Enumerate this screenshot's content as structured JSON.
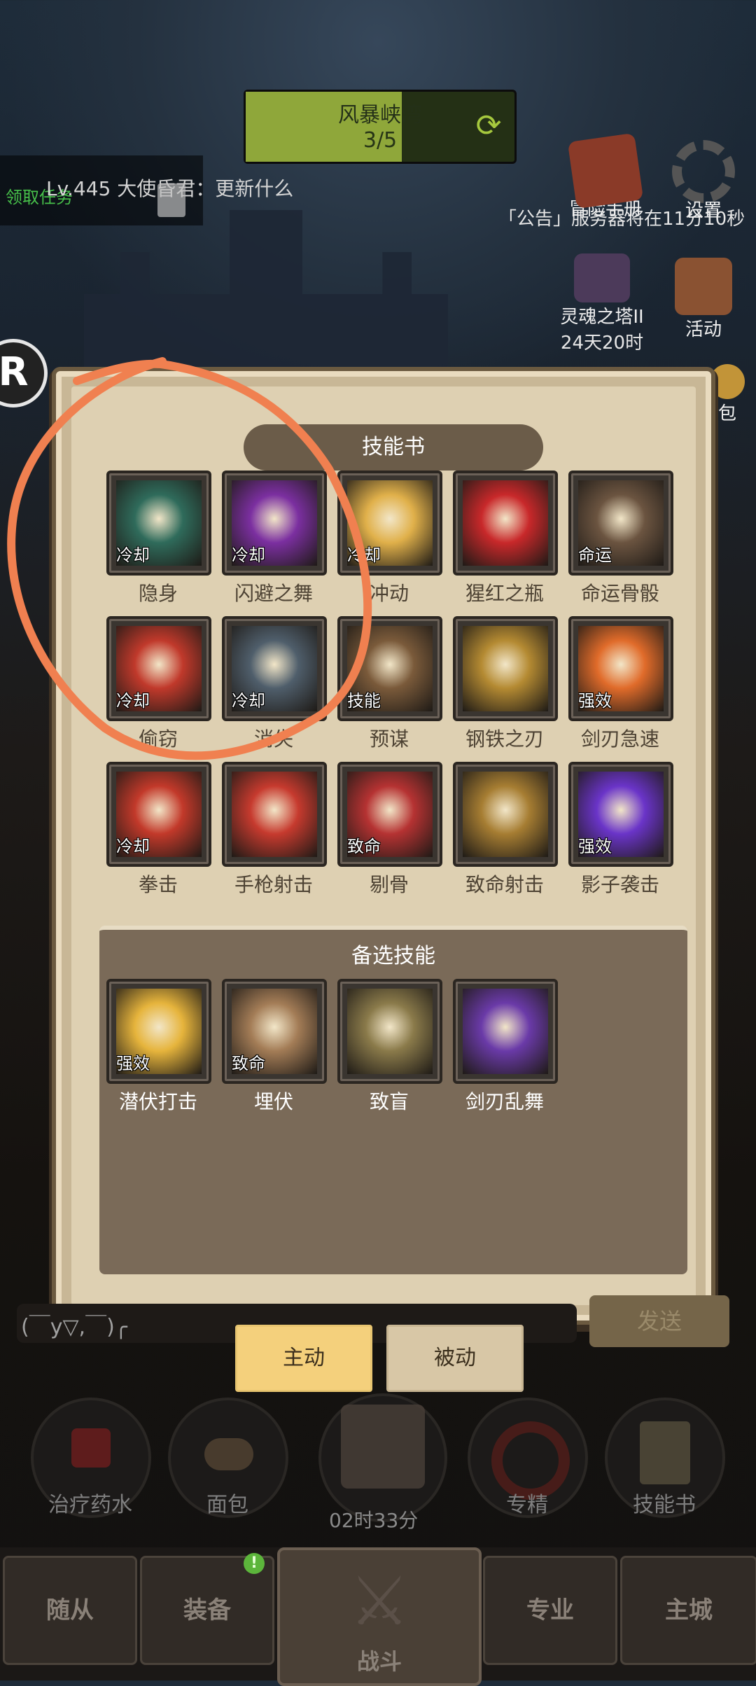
{
  "hud": {
    "stage_name": "风暴峡湾",
    "stage_progress": "3/5",
    "chat_task": "领取任务",
    "chat_message": "Lv.445 大使昏君：更新什么",
    "announcement": "「公告」服务器将在11分10秒",
    "adventure_label": "冒险手册",
    "settings_label": "设置",
    "soul_tower_label": "灵魂之塔II",
    "soul_tower_time": "24天20时",
    "activity_label": "活动",
    "bag_label": "包",
    "round_badge": "R"
  },
  "panel": {
    "title": "技能书",
    "skills": [
      {
        "name": "隐身",
        "tag": "冷却",
        "icon": "hooded-figure-icon",
        "color": "#2f6b5b"
      },
      {
        "name": "闪避之舞",
        "tag": "冷却",
        "icon": "purple-shadow-icon",
        "color": "#7b2fa0"
      },
      {
        "name": "冲动",
        "tag": "冷却",
        "icon": "spiral-burst-icon",
        "color": "#e0b04a"
      },
      {
        "name": "猩红之瓶",
        "tag": "",
        "icon": "red-potion-icon",
        "color": "#c8282a"
      },
      {
        "name": "命运骨骰",
        "tag": "命运",
        "icon": "bone-dice-icon",
        "color": "#6b5440"
      },
      {
        "name": "偷窃",
        "tag": "冷却",
        "icon": "red-bag-icon",
        "color": "#c0392b"
      },
      {
        "name": "消失",
        "tag": "冷却",
        "icon": "grey-rock-icon",
        "color": "#4f5e6b"
      },
      {
        "name": "预谋",
        "tag": "技能",
        "icon": "masked-face-icon",
        "color": "#7a5a3a"
      },
      {
        "name": "钢铁之刃",
        "tag": "",
        "icon": "steel-blade-icon",
        "color": "#b48a32"
      },
      {
        "name": "剑刃急速",
        "tag": "强效",
        "icon": "swift-blade-icon",
        "color": "#e06b2a"
      },
      {
        "name": "拳击",
        "tag": "冷却",
        "icon": "fist-icon",
        "color": "#c2392a"
      },
      {
        "name": "手枪射击",
        "tag": "",
        "icon": "pistol-shot-icon",
        "color": "#c63a2e"
      },
      {
        "name": "剔骨",
        "tag": "致命",
        "icon": "bone-knife-icon",
        "color": "#b53232"
      },
      {
        "name": "致命射击",
        "tag": "",
        "icon": "cannon-icon",
        "color": "#a67d32"
      },
      {
        "name": "影子袭击",
        "tag": "强效",
        "icon": "shadow-claw-icon",
        "color": "#6a34c8"
      }
    ],
    "backup_title": "备选技能",
    "backup_skills": [
      {
        "name": "潜伏打击",
        "tag": "强效",
        "icon": "dagger-strike-icon",
        "color": "#e6b43c"
      },
      {
        "name": "埋伏",
        "tag": "致命",
        "icon": "ambush-hand-icon",
        "color": "#a37c56"
      },
      {
        "name": "致盲",
        "tag": "",
        "icon": "blind-eye-icon",
        "color": "#8a7a4a"
      },
      {
        "name": "剑刃乱舞",
        "tag": "",
        "icon": "blade-flurry-icon",
        "color": "#6a3aa8"
      }
    ]
  },
  "chat": {
    "input_text": "(￣y▽,￣)╭",
    "send_label": "发送"
  },
  "tabs": {
    "active": "主动",
    "passive": "被动"
  },
  "actions": [
    {
      "label": "治疗药水",
      "icon": "healing-potion-icon"
    },
    {
      "label": "面包",
      "icon": "bread-icon"
    },
    {
      "label": "",
      "icon": "treasure-chest-icon"
    },
    {
      "label": "专精",
      "icon": "specialization-icon"
    },
    {
      "label": "技能书",
      "icon": "skill-book-icon"
    }
  ],
  "timer": "02时33分",
  "nav": {
    "followers": "随从",
    "equipment": "装备",
    "battle": "战斗",
    "profession": "专业",
    "main_city": "主城",
    "notif_badge": "!"
  }
}
